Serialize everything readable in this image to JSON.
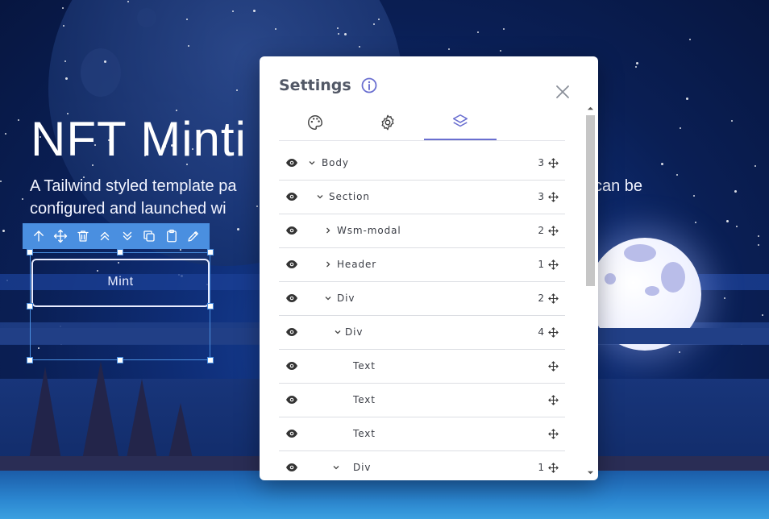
{
  "hero": {
    "title": "NFT Minti",
    "line1_left": "A Tailwind styled template pa",
    "line1_right": "can be",
    "line2_left": "configured and launched wi"
  },
  "element": {
    "button_label": "Mint"
  },
  "toolbar_icons": [
    "arrow-up-icon",
    "move-icon",
    "trash-icon",
    "chevrons-up-icon",
    "chevrons-down-icon",
    "copy-icon",
    "clipboard-icon",
    "pencil-icon"
  ],
  "settings": {
    "title": "Settings",
    "tabs": [
      "palette-icon",
      "gear-icon",
      "layers-icon"
    ],
    "active_tab": "layers-icon",
    "accent": "#6a6fd0",
    "layers": [
      {
        "name": "Body",
        "count": "3",
        "chevron": "down",
        "indent": 0
      },
      {
        "name": "Section",
        "count": "3",
        "chevron": "down",
        "indent": 1
      },
      {
        "name": "Wsm-modal",
        "count": "2",
        "chevron": "right",
        "indent": 2
      },
      {
        "name": "Header",
        "count": "1",
        "chevron": "right",
        "indent": 2
      },
      {
        "name": "Div",
        "count": "2",
        "chevron": "down",
        "indent": 2
      },
      {
        "name": "Div",
        "count": "4",
        "chevron": "down",
        "indent": 3
      },
      {
        "name": "Text",
        "count": "",
        "chevron": "",
        "indent": 4
      },
      {
        "name": "Text",
        "count": "",
        "chevron": "",
        "indent": 4
      },
      {
        "name": "Text",
        "count": "",
        "chevron": "",
        "indent": 4
      },
      {
        "name": "Div",
        "count": "1",
        "chevron": "down",
        "indent": 4
      }
    ]
  }
}
